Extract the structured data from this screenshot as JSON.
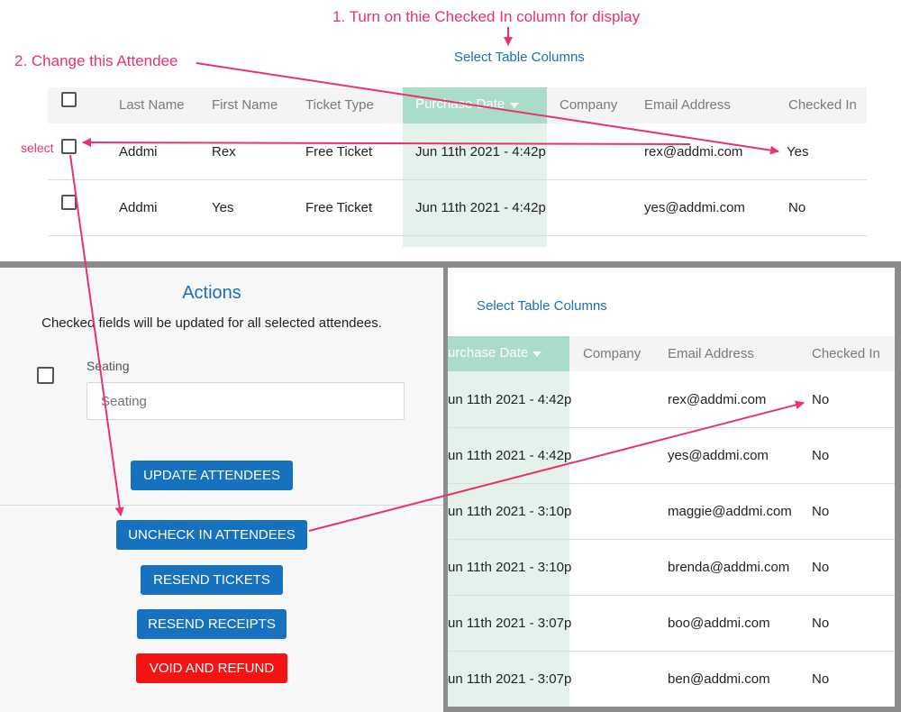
{
  "annotations": {
    "step1": "1. Turn on thie Checked In column for display",
    "step2": "2. Change this Attendee",
    "select": "select"
  },
  "top_table": {
    "select_columns_link": "Select Table Columns",
    "headers": [
      "Last Name",
      "First Name",
      "Ticket Type",
      "Purchase Date",
      "Company",
      "Email Address",
      "Checked In"
    ],
    "sort_indicator": "caret-down-icon",
    "rows": [
      {
        "last": "Addmi",
        "first": "Rex",
        "ticket": "Free Ticket",
        "date": "Jun 11th 2021 - 4:42p",
        "company": "",
        "email": "rex@addmi.com",
        "checked": "Yes"
      },
      {
        "last": "Addmi",
        "first": "Yes",
        "ticket": "Free Ticket",
        "date": "Jun 11th 2021 - 4:42p",
        "company": "",
        "email": "yes@addmi.com",
        "checked": "No"
      }
    ]
  },
  "actions_panel": {
    "title": "Actions",
    "description": "Checked fields will be updated for all selected attendees.",
    "seating_label": "Seating",
    "seating_placeholder": "Seating",
    "buttons": {
      "update": "UPDATE ATTENDEES",
      "uncheck": "UNCHECK IN ATTENDEES",
      "resend_tickets": "RESEND TICKETS",
      "resend_receipts": "RESEND RECEIPTS",
      "void": "VOID AND REFUND"
    }
  },
  "bottom_table": {
    "select_columns_link": "Select Table Columns",
    "headers": [
      "urchase Date",
      "Company",
      "Email Address",
      "Checked In"
    ],
    "rows": [
      {
        "date": "un 11th 2021 - 4:42p",
        "email": "rex@addmi.com",
        "checked": "No"
      },
      {
        "date": "un 11th 2021 - 4:42p",
        "email": "yes@addmi.com",
        "checked": "No"
      },
      {
        "date": "un 11th 2021 - 3:10p",
        "email": "maggie@addmi.com",
        "checked": "No"
      },
      {
        "date": "un 11th 2021 - 3:10p",
        "email": "brenda@addmi.com",
        "checked": "No"
      },
      {
        "date": "un 11th 2021 - 3:07p",
        "email": "boo@addmi.com",
        "checked": "No"
      },
      {
        "date": "un 11th 2021 - 3:07p",
        "email": "ben@addmi.com",
        "checked": "No"
      }
    ]
  },
  "colors": {
    "accent": "#e8336b",
    "link": "#1a6fb7",
    "sorted_header": "#a9dcc9",
    "sorted_column": "#e3f3ec",
    "button_blue": "#1672be",
    "button_red": "#f41414"
  }
}
